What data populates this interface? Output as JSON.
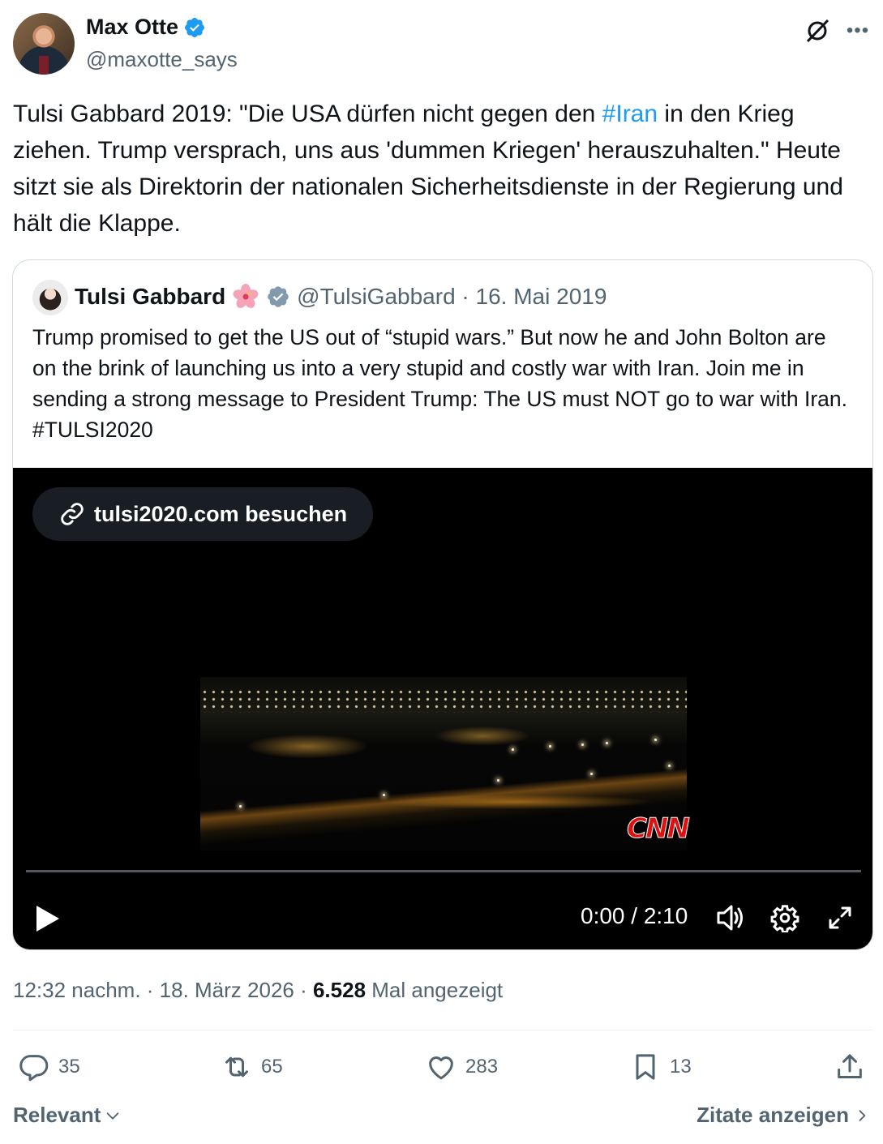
{
  "author": {
    "name": "Max Otte",
    "handle": "@maxotte_says"
  },
  "icons": {
    "verified": "verified-badge-icon",
    "grok": "grok-icon",
    "more": "more-icon",
    "link": "link-icon",
    "play": "play-icon",
    "volume": "volume-icon",
    "settings": "gear-icon",
    "fullscreen": "fullscreen-icon",
    "reply": "reply-icon",
    "repost": "repost-icon",
    "like": "heart-icon",
    "bookmark": "bookmark-icon",
    "share": "share-icon"
  },
  "tweet": {
    "text_before": "Tulsi Gabbard 2019: \"Die USA dürfen nicht gegen den ",
    "hashtag": "#Iran",
    "text_after": " in den Krieg ziehen. Trump versprach, uns aus 'dummen Kriegen' herauszuhalten.\" Heute sitzt sie als Direktorin der nationalen Sicherheitsdienste in der Regierung und hält die Klappe."
  },
  "quote": {
    "name": "Tulsi Gabbard",
    "handle_date": "@TulsiGabbard · 16. Mai 2019",
    "text": "Trump promised to get the US out of “stupid wars.” But now he and John Bolton are on the brink of launching us into a very stupid and costly war with Iran. Join me in sending a strong message to President Trump: The US must NOT go to war with Iran. #TULSI2020",
    "video": {
      "link_label": "tulsi2020.com besuchen",
      "time": "0:00 / 2:10",
      "watermark": "CNN"
    }
  },
  "meta": {
    "time_date": "12:32 nachm. · 18. März 2026 · ",
    "views": "6.528",
    "views_label": " Mal angezeigt"
  },
  "actions": {
    "replies": "35",
    "reposts": "65",
    "likes": "283",
    "bookmarks": "13"
  },
  "footer": {
    "sort_label": "Relevant",
    "quotes_label": "Zitate anzeigen"
  },
  "colors": {
    "link": "#1d9bf0",
    "secondary_text": "#536471",
    "verified_blue": "#1d9bf0",
    "verified_gray": "#829aab"
  }
}
